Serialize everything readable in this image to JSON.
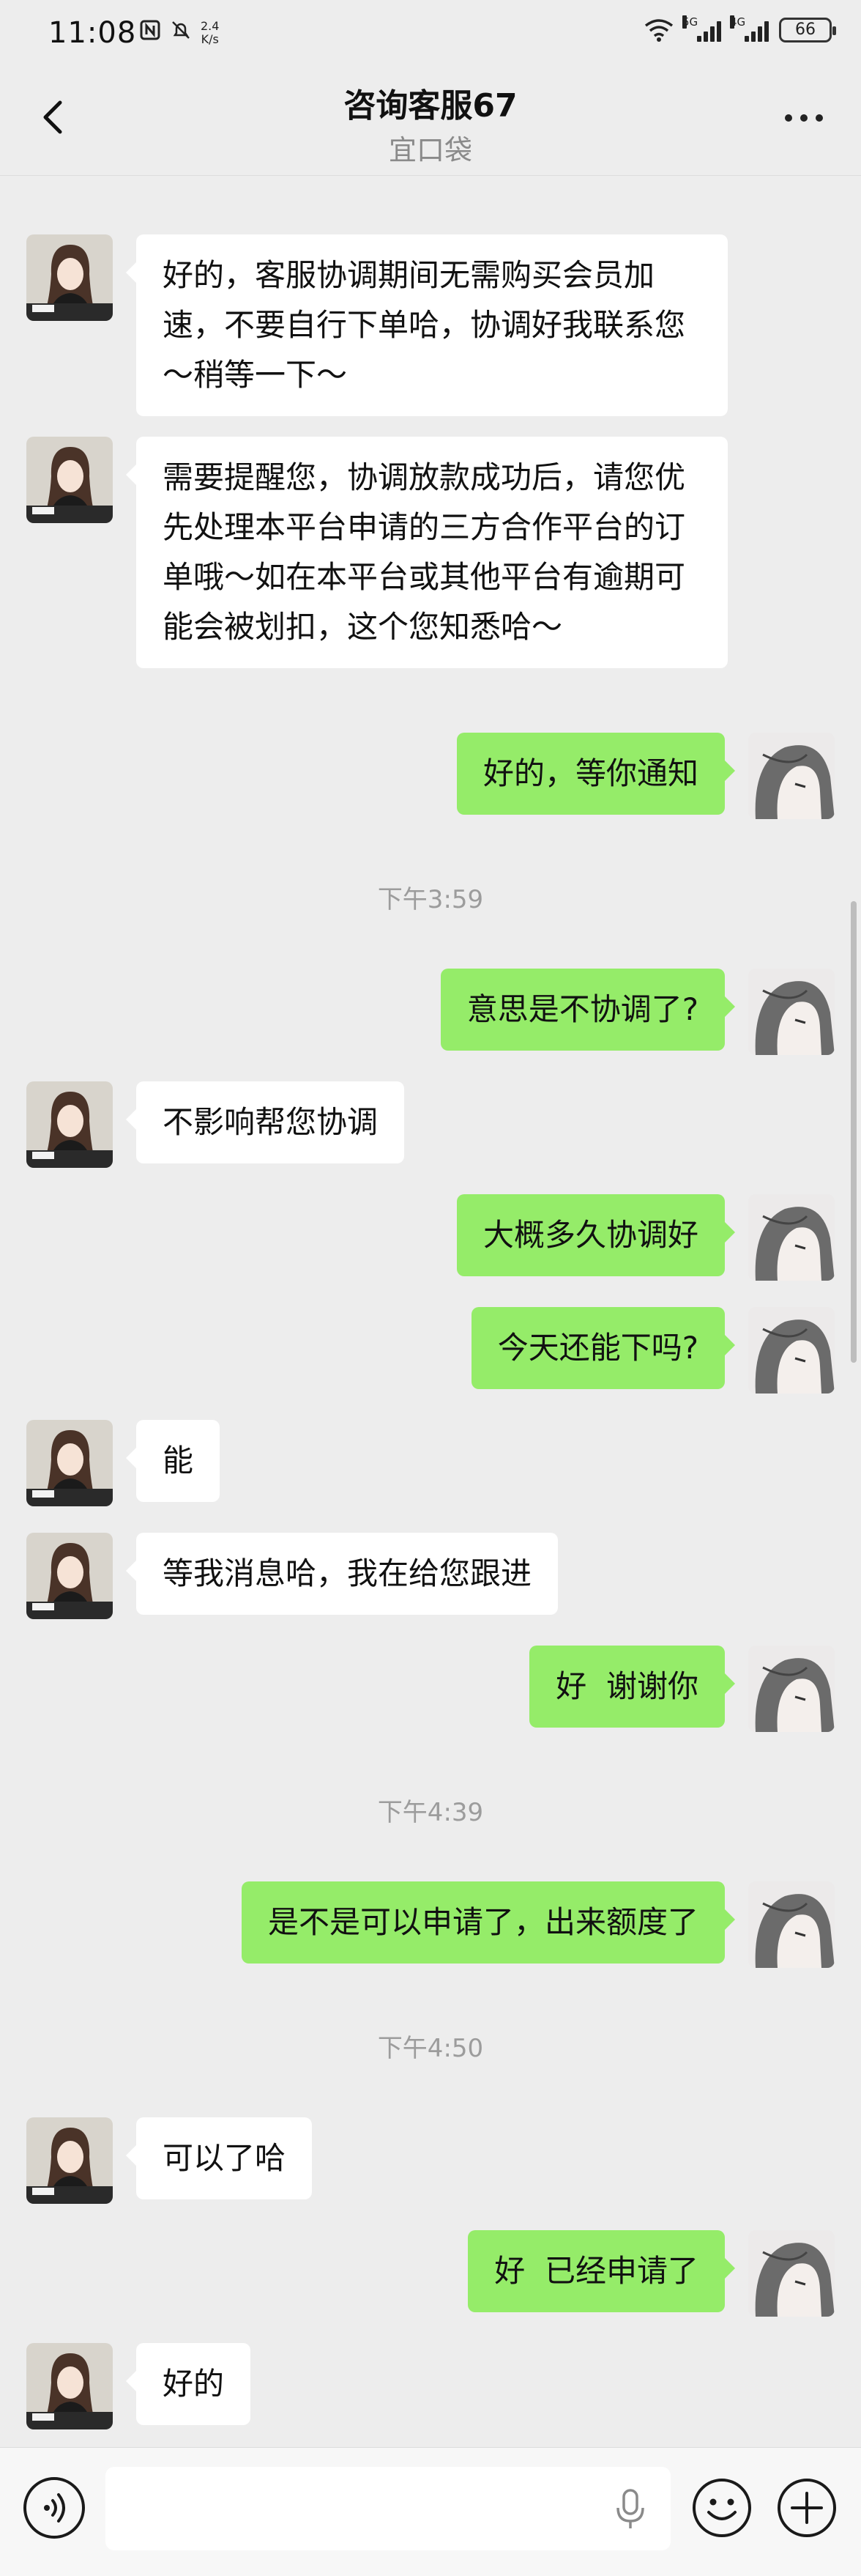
{
  "status_bar": {
    "time": "11:08",
    "net_speed_value": "2.4",
    "net_speed_unit": "K/s",
    "signal1_label": "5G",
    "signal2_label": "4G",
    "battery": "66"
  },
  "header": {
    "title": "咨询客服67",
    "subtitle": "宜口袋"
  },
  "messages": [
    {
      "side": "left",
      "text": "好的，客服协调期间无需购买会员加速，不要自行下单哈，协调好我联系您～稍等一下～"
    },
    {
      "side": "left",
      "text": "需要提醒您，协调放款成功后，请您优先处理本平台申请的三方合作平台的订单哦～如在本平台或其他平台有逾期可能会被划扣，这个您知悉哈～"
    },
    {
      "side": "right",
      "text": "好的，等你通知"
    },
    {
      "timestamp": "下午3:59"
    },
    {
      "side": "right",
      "text": "意思是不协调了?"
    },
    {
      "side": "left",
      "text": "不影响帮您协调"
    },
    {
      "side": "right",
      "text": "大概多久协调好"
    },
    {
      "side": "right",
      "text": "今天还能下吗?"
    },
    {
      "side": "left",
      "text": "能"
    },
    {
      "side": "left",
      "text": "等我消息哈，我在给您跟进"
    },
    {
      "side": "right",
      "text": "好  谢谢你"
    },
    {
      "timestamp": "下午4:39"
    },
    {
      "side": "right",
      "text": "是不是可以申请了，出来额度了"
    },
    {
      "timestamp": "下午4:50"
    },
    {
      "side": "left",
      "text": "可以了哈"
    },
    {
      "side": "right",
      "text": "好  已经申请了"
    },
    {
      "side": "left",
      "text": "好的"
    }
  ],
  "colors": {
    "background": "#ededed",
    "sent_bubble": "#95ec69",
    "received_bubble": "#ffffff"
  },
  "icons": {
    "back": "chevron-left-icon",
    "more": "more-dots-icon",
    "voice": "voice-icon",
    "mic": "microphone-icon",
    "emoji": "emoji-icon",
    "plus": "plus-icon"
  }
}
